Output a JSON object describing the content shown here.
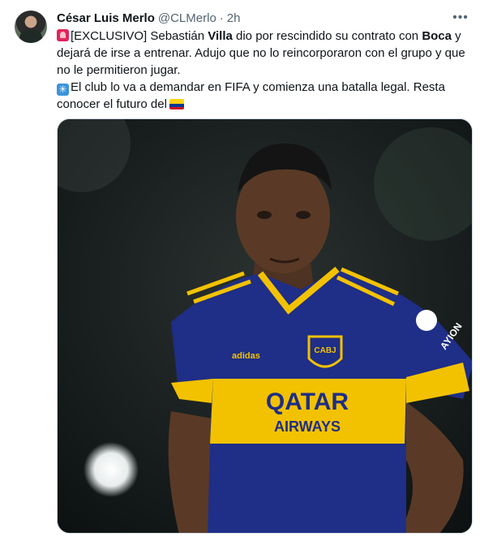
{
  "author": {
    "name": "César Luis Merlo",
    "handle": "@CLMerlo",
    "separator": "·",
    "time": "2h"
  },
  "more_icon": "more-horizontal-icon",
  "tweet": {
    "line1_emoji": "police-light-emoji",
    "line1_a": "[EXCLUSIVO] Sebastián ",
    "line1_b": "Villa",
    "line1_c": " dio por rescindido su contrato con ",
    "line1_d": "Boca",
    "line1_e": " y",
    "line2": "dejará de irse a entrenar. Adujo que no lo reincorporaron con el grupo y que",
    "line3": "no le permitieron jugar.",
    "line4_emoji": "eight-spoked-asterisk-emoji",
    "line4": "El club lo va a demandar en FIFA y comienza una batalla legal. Resta",
    "line5": "conocer el futuro del",
    "line5_emoji": "colombia-flag-emoji"
  },
  "media": {
    "description_icon": "photo-image",
    "jersey_sponsor_line1": "QATAR",
    "jersey_sponsor_line2": "AIRWAYS",
    "jersey_badge": "CABJ",
    "sleeve_text": "AYION",
    "brand_text": "adidas",
    "colors": {
      "jersey_blue": "#1f2e86",
      "jersey_yellow": "#f2c200",
      "background": "#0f1416"
    }
  }
}
